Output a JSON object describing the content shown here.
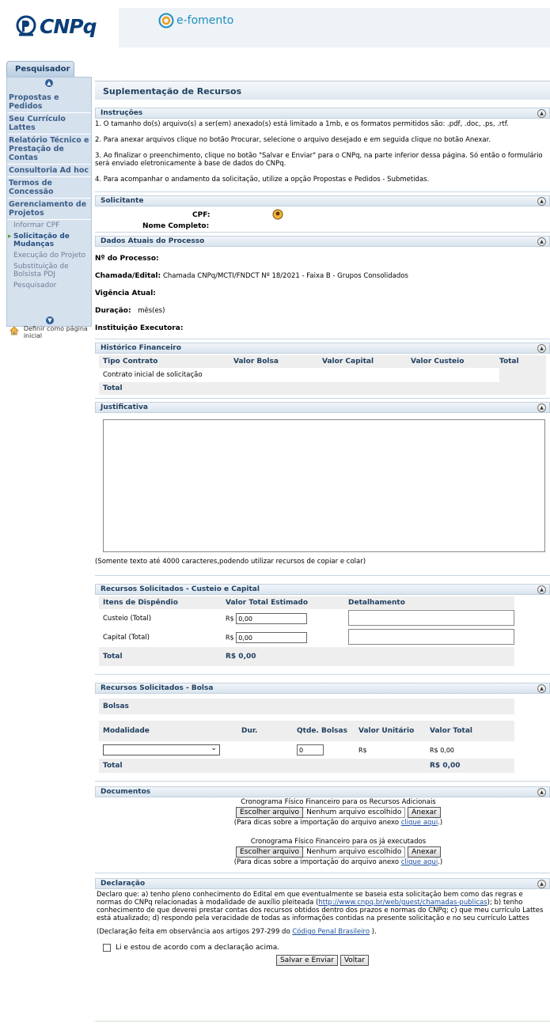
{
  "header": {
    "logo_text": "CNPq",
    "efomento_text": "e-fomento"
  },
  "sidebar": {
    "tab_label": "Pesquisador",
    "items": [
      {
        "label": "Propostas e Pedidos",
        "type": "item"
      },
      {
        "label": "Seu Currículo Lattes",
        "type": "item"
      },
      {
        "label": "Relatório Técnico e Prestação de Contas",
        "type": "item"
      },
      {
        "label": "Consultoria Ad hoc",
        "type": "item"
      },
      {
        "label": "Termos de Concessão",
        "type": "item"
      },
      {
        "label": "Gerenciamento de Projetos",
        "type": "item"
      }
    ],
    "subitems": [
      {
        "label": "Informar CPF"
      },
      {
        "label": "Solicitação de Mudanças",
        "active": true
      },
      {
        "label": "Execução do Projeto"
      },
      {
        "label": "Substituição de Bolsista PDJ"
      },
      {
        "label": "Pesquisador"
      }
    ],
    "definir_label": "Definir como página inicial"
  },
  "page": {
    "title": "Suplementação de Recursos"
  },
  "instrucoes": {
    "title": "Instruções",
    "lines": [
      "1. O tamanho do(s) arquivo(s) a ser(em) anexado(s) está limitado a 1mb, e os formatos permitidos são: .pdf, .doc, .ps, .rtf.",
      "2. Para anexar arquivos clique no botão Procurar, selecione o arquivo desejado e em seguida clique no botão Anexar.",
      "3. Ao finalizar o preenchimento, clique no botão \"Salvar e Enviar\" para o CNPq, na parte inferior dessa página. Só então o formulário será enviado eletronicamente à base de dados do CNPq.",
      "4. Para acompanhar o andamento da solicitação, utilize a opção Propostas e Pedidos - Submetidas."
    ]
  },
  "solicitante": {
    "title": "Solicitante",
    "cpf_label": "CPF:",
    "nome_label": "Nome Completo:"
  },
  "dados": {
    "title": "Dados Atuais do Processo",
    "processo_label": "Nº do Processo:",
    "chamada_label": "Chamada/Edital:",
    "chamada_value": "Chamada CNPq/MCTI/FNDCT Nº 18/2021 - Faixa B - Grupos Consolidados",
    "vigencia_label": "Vigência Atual:",
    "duracao_label": "Duração:",
    "duracao_value": "mês(es)",
    "instituicao_label": "Instituição Executora:"
  },
  "historico": {
    "title": "Histórico Financeiro",
    "columns": [
      "Tipo Contrato",
      "Valor Bolsa",
      "Valor Capital",
      "Valor Custeio",
      "Total"
    ],
    "row": "Contrato inicial de solicitação",
    "total_label": "Total"
  },
  "justificativa": {
    "title": "Justificativa",
    "note": "(Somente texto até 4000 caracteres,podendo utilizar recursos de copiar e colar)"
  },
  "recursos": {
    "title": "Recursos Solicitados - Custeio e Capital",
    "col_itens": "Itens de Dispêndio",
    "col_valor": "Valor Total Estimado",
    "col_detalhe": "Detalhamento",
    "custeio_label": "Custeio (Total)",
    "capital_label": "Capital (Total)",
    "currency": "R$",
    "custeio_value": "0,00",
    "capital_value": "0,00",
    "total_label": "Total",
    "total_value": "R$ 0,00"
  },
  "bolsa": {
    "title": "Recursos Solicitados - Bolsa",
    "bolsas_label": "Bolsas",
    "col_modalidade": "Modalidade",
    "col_dur": "Dur.",
    "col_qtde": "Qtde. Bolsas",
    "col_unit": "Valor Unitário",
    "col_total": "Valor Total",
    "qtde_value": "0",
    "unit_value": "R$",
    "total_row_value": "R$  0,00",
    "total_label": "Total",
    "total_value": "R$  0,00"
  },
  "documentos": {
    "title": "Documentos",
    "doc1_label": "Cronograma Físico Financeiro para os Recursos Adicionais",
    "doc2_label": "Cronograma Físico Financeiro para os já executados",
    "choose_btn": "Escolher arquivo",
    "no_file": "Nenhum arquivo escolhido",
    "attach_btn": "Anexar",
    "hint_prefix": "(Para dicas sobre a importação do arquivo anexo ",
    "hint_link": "clique aqui",
    "hint_suffix": ".)"
  },
  "declaracao": {
    "title": "Declaração",
    "text_part1": "Declaro que: a) tenho pleno conhecimento do Edital em que eventualmente se baseia esta solicitação bem como das regras e normas do CNPq relacionadas à modalidade de auxílio pleiteada (",
    "link_url": "http://www.cnpq.br/web/guest/chamadas-publicas",
    "text_part2": "); b) tenho conhecimento de que deverei prestar contas dos recursos obtidos dentro dos prazos e normas do CNPq; c) que meu currículo Lattes está atualizado; d) respondo pela veracidade de todas as informações contidas na presente solicitação e no seu currículo Lattes",
    "obs_prefix": "(Declaração feita em observância aos artigos 297-299 do ",
    "obs_link": "Código Penal Brasileiro",
    "obs_suffix": " ).",
    "checkbox_label": "Li e estou de acordo com a declaração acima."
  },
  "actions": {
    "save_label": "Salvar e Enviar",
    "back_label": "Voltar"
  }
}
